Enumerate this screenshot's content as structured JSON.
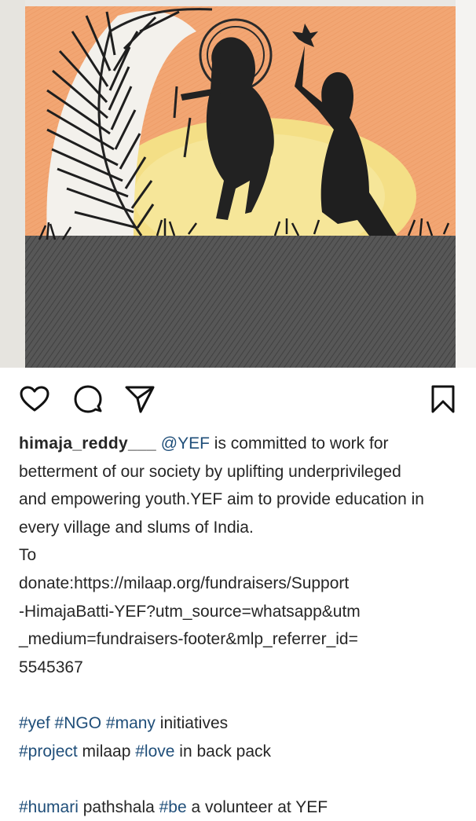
{
  "post": {
    "image": {
      "description_icon": "artwork-image"
    },
    "actions": {
      "like_icon": "heart-icon",
      "comment_icon": "comment-icon",
      "share_icon": "send-icon",
      "save_icon": "bookmark-icon"
    },
    "caption": {
      "username": "himaja_reddy___",
      "mention": "@YEF",
      "line1_rest": " is committed to work for",
      "line2": "betterment of our society by uplifting underprivileged",
      "line3": "and empowering youth.YEF aim to provide education in",
      "line4": "every village and slums of India.",
      "line5": "To",
      "line6": "donate:https://milaap.org/fundraisers/Support",
      "line7": "-HimajaBatti-YEF?utm_source=whatsapp&utm",
      "line8": "_medium=fundraisers-footer&mlp_referrer_id=",
      "line9": "5545367",
      "tags1": {
        "t1": "#yef",
        "t2": "#NGO",
        "t3": "#many",
        "rest": " initiatives"
      },
      "tags2": {
        "t1": "#project",
        "mid": " milaap ",
        "t2": "#love",
        "rest": " in back pack"
      },
      "tags3": {
        "t1": "#humari",
        "mid": " pathshala ",
        "t2": "#be",
        "rest": " a volunteer at YEF"
      }
    }
  },
  "colors": {
    "text": "#262626",
    "link": "#1f4e79",
    "sky": "#f0a070",
    "sun": "#f3dc7a",
    "ground": "#4a4a4a"
  }
}
